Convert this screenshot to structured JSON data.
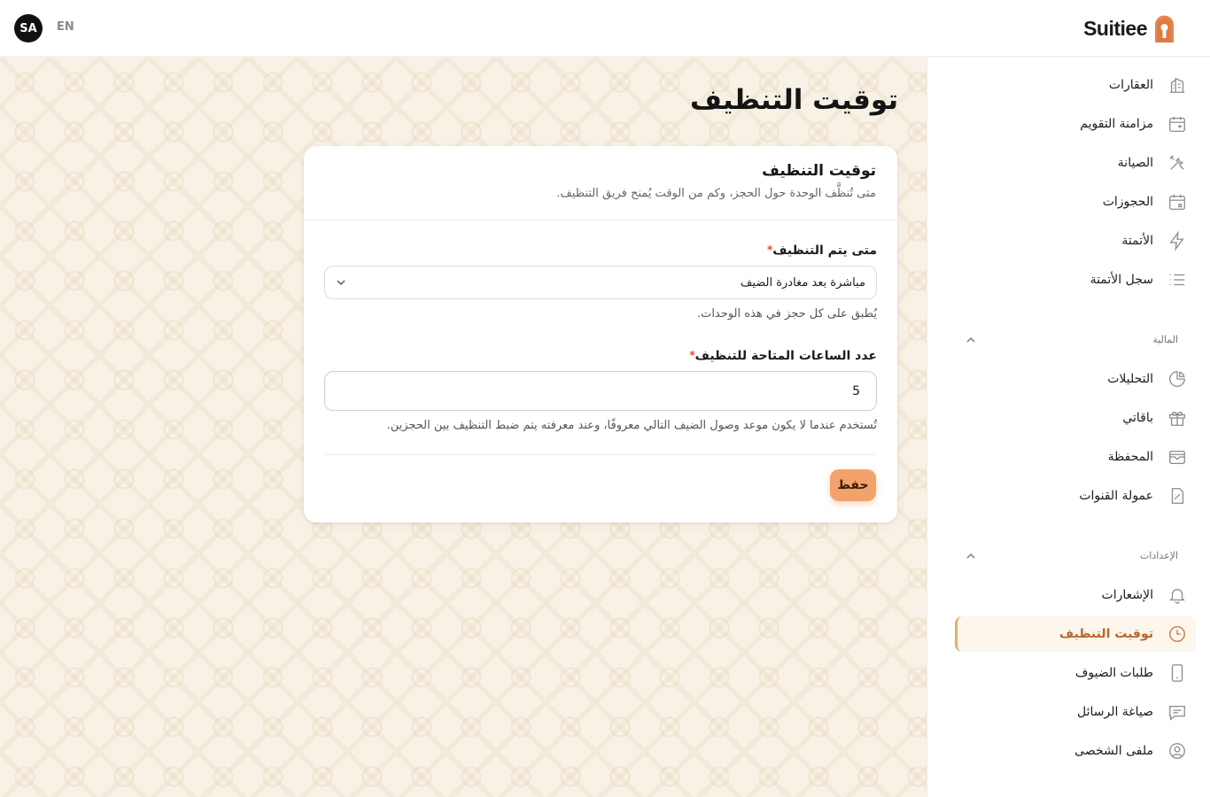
{
  "header": {
    "user_initials": "SA",
    "language_toggle": "EN",
    "brand_name": "Suitiee"
  },
  "page": {
    "title": "توقيت التنظيف"
  },
  "card": {
    "title": "توقيت التنظيف",
    "subtitle": "متى تُنظَّف الوحدة حول الحجز، وكم من الوقت يُمنح فريق التنظيف.",
    "field1": {
      "label": "متى يتم التنظيف",
      "required_mark": "*",
      "selected_value": "مباشرة بعد مغادرة الضيف",
      "helper": "يُطبق على كل حجز في هذه الوحدات."
    },
    "field2": {
      "label": "عدد الساعات المتاحة للتنظيف",
      "required_mark": "*",
      "value": "5",
      "helper": "تُستخدم عندما لا يكون موعد وصول الضيف التالي معروفًا، وعند معرفته يتم ضبط التنظيف بين الحجزين."
    },
    "save_label": "حفظ"
  },
  "sidebar": {
    "items": [
      {
        "label": "العقارات",
        "icon": "building-icon"
      },
      {
        "label": "مزامنة التقويم",
        "icon": "calendar-sync-icon"
      },
      {
        "label": "الصيانة",
        "icon": "tools-icon"
      },
      {
        "label": "الحجوزات",
        "icon": "calendar-icon"
      },
      {
        "label": "الأتمتة",
        "icon": "lightning-icon"
      },
      {
        "label": "سجل الأتمتة",
        "icon": "list-icon"
      }
    ],
    "finance_section": {
      "label": "المالية",
      "items": [
        {
          "label": "التحليلات",
          "icon": "pie-chart-icon"
        },
        {
          "label": "باقاتي",
          "icon": "gift-icon"
        },
        {
          "label": "المحفظة",
          "icon": "wallet-icon"
        },
        {
          "label": "عمولة القنوات",
          "icon": "percent-doc-icon"
        }
      ]
    },
    "settings_section": {
      "label": "الإعدادات",
      "items": [
        {
          "label": "الإشعارات",
          "icon": "bell-icon"
        },
        {
          "label": "توقيت التنظيف",
          "icon": "clock-icon",
          "active": true
        },
        {
          "label": "طلبات الضيوف",
          "icon": "phone-icon"
        },
        {
          "label": "صياغة الرسائل",
          "icon": "chat-icon"
        },
        {
          "label": "ملفى الشخصى",
          "icon": "user-circle-icon"
        }
      ]
    }
  },
  "colors": {
    "accent": "#f4a26b",
    "active_text": "#b8662a",
    "active_border": "#d9b66a",
    "brand_logo": "#e8834a"
  }
}
